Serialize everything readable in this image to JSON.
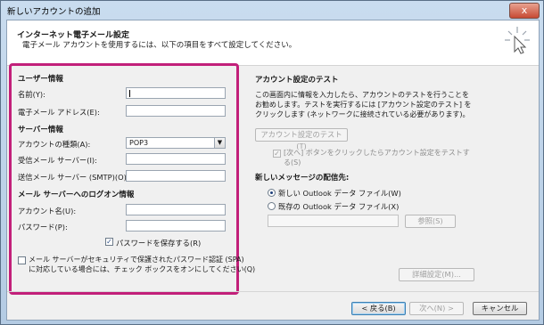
{
  "window": {
    "title": "新しいアカウントの追加",
    "close": "x"
  },
  "header": {
    "title": "インターネット電子メール設定",
    "subtitle": "電子メール アカウントを使用するには、以下の項目をすべて設定してください。"
  },
  "user_info": {
    "heading": "ユーザー情報",
    "name_label": "名前(Y):",
    "name_value": "",
    "email_label": "電子メール アドレス(E):",
    "email_value": ""
  },
  "server_info": {
    "heading": "サーバー情報",
    "account_type_label": "アカウントの種類(A):",
    "account_type_value": "POP3",
    "incoming_label": "受信メール サーバー(I):",
    "incoming_value": "",
    "outgoing_label": "送信メール サーバー (SMTP)(O):",
    "outgoing_value": ""
  },
  "logon_info": {
    "heading": "メール サーバーへのログオン情報",
    "account_name_label": "アカウント名(U):",
    "account_name_value": "",
    "password_label": "パスワード(P):",
    "password_value": "",
    "remember_password_label": "パスワードを保存する(R)",
    "remember_password_checked": true,
    "spa_line1": "メール サーバーがセキュリティで保護されたパスワード認証 (SPA)",
    "spa_line2": "に対応している場合には、チェック ボックスをオンにしてください(Q)",
    "spa_checked": false
  },
  "test_settings": {
    "heading": "アカウント設定のテスト",
    "desc1": "この画面内に情報を入力したら、アカウントのテストを行うことを",
    "desc2": "お勧めします。テストを実行するには [アカウント設定のテスト] を",
    "desc3": "クリックします (ネットワークに接続されている必要があります)。",
    "test_button": "アカウント設定のテスト(T)",
    "auto_test_line1": "[次へ] ボタンをクリックしたらアカウント設定をテストす",
    "auto_test_line2": "る(S)",
    "auto_test_checked": true
  },
  "delivery": {
    "heading": "新しいメッセージの配信先:",
    "new_file_label": "新しい Outlook データ ファイル(W)",
    "existing_file_label": "既存の Outlook データ ファイル(X)",
    "selected": "new",
    "file_path": "",
    "browse_button": "参照(S)"
  },
  "more_settings_button": "詳細設定(M)...",
  "footer": {
    "back_button": "< 戻る(B)",
    "next_button": "次へ(N) >",
    "cancel_button": "キャンセル"
  },
  "colors": {
    "highlight_border": "#c2207a"
  }
}
